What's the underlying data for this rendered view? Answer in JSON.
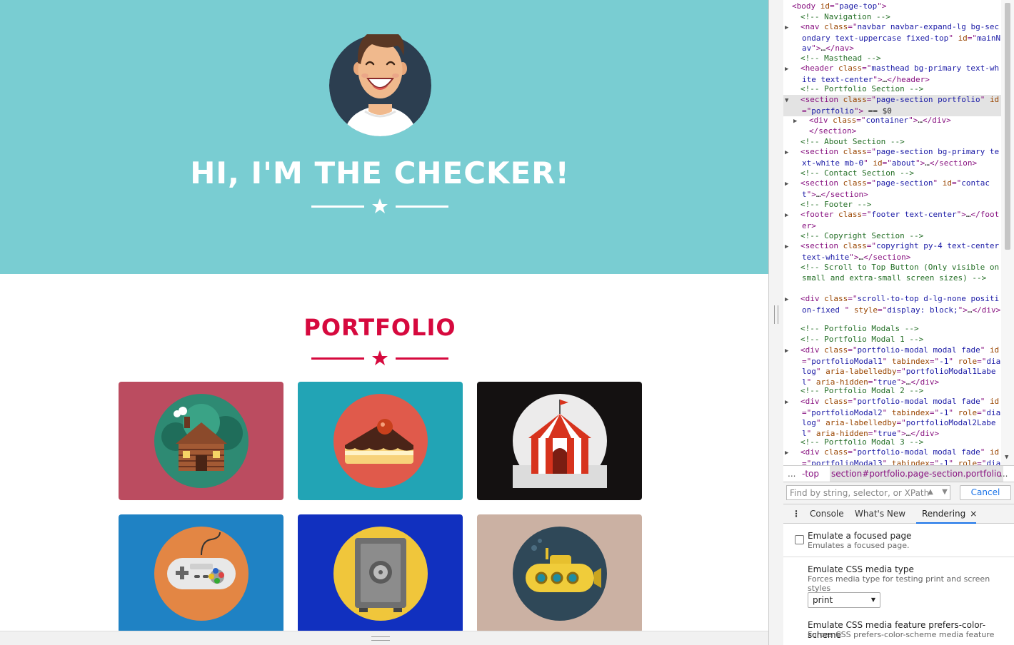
{
  "page": {
    "hero_title": "HI, I'M THE CHECKER!",
    "portfolio_title": "PORTFOLIO",
    "colors": {
      "masthead": "#79cdd2",
      "accent": "#d6093e",
      "white": "#ffffff"
    },
    "cards": [
      {
        "name": "cabin",
        "bg": "#bb4c60",
        "icon": "cabin-icon"
      },
      {
        "name": "cake",
        "bg": "#22a4b5",
        "icon": "cake-icon"
      },
      {
        "name": "circus",
        "bg": "#141111",
        "icon": "circus-tent-icon"
      },
      {
        "name": "game",
        "bg": "#1f82c4",
        "icon": "gamepad-icon"
      },
      {
        "name": "safe",
        "bg": "#1130bf",
        "icon": "safe-icon"
      },
      {
        "name": "submarine",
        "bg": "#cbb1a3",
        "icon": "submarine-icon"
      }
    ]
  },
  "devtools": {
    "tree": [
      {
        "indent": 0,
        "tri": "▼",
        "parts": [
          [
            "tag",
            "<body "
          ],
          [
            "attr",
            "id"
          ],
          [
            "tag",
            "=\""
          ],
          [
            "val",
            "page-top"
          ],
          [
            "tag",
            "\">"
          ]
        ]
      },
      {
        "indent": 1,
        "tri": "",
        "parts": [
          [
            "cmt",
            "<!-- Navigation -->"
          ]
        ]
      },
      {
        "indent": 1,
        "tri": "▶",
        "parts": [
          [
            "tag",
            "<nav "
          ],
          [
            "attr",
            "class"
          ],
          [
            "tag",
            "=\""
          ],
          [
            "val",
            "navbar navbar-expand-lg bg-secondary text-uppercase fixed-top"
          ],
          [
            "tag",
            "\" "
          ],
          [
            "attr",
            "id"
          ],
          [
            "tag",
            "=\""
          ],
          [
            "val",
            "mainNav"
          ],
          [
            "tag",
            "\">"
          ],
          [
            "txt",
            "…"
          ],
          [
            "tag",
            "</nav>"
          ]
        ]
      },
      {
        "indent": 1,
        "tri": "",
        "parts": [
          [
            "cmt",
            "<!-- Masthead -->"
          ]
        ]
      },
      {
        "indent": 1,
        "tri": "▶",
        "parts": [
          [
            "tag",
            "<header "
          ],
          [
            "attr",
            "class"
          ],
          [
            "tag",
            "=\""
          ],
          [
            "val",
            "masthead bg-primary text-white text-center"
          ],
          [
            "tag",
            "\">"
          ],
          [
            "txt",
            "…"
          ],
          [
            "tag",
            "</header>"
          ]
        ]
      },
      {
        "indent": 1,
        "tri": "",
        "parts": [
          [
            "cmt",
            "<!-- Portfolio Section -->"
          ]
        ]
      },
      {
        "indent": 1,
        "tri": "▼",
        "sel": true,
        "parts": [
          [
            "tag",
            "<section "
          ],
          [
            "attr",
            "class"
          ],
          [
            "tag",
            "=\""
          ],
          [
            "val",
            "page-section portfolio"
          ],
          [
            "tag",
            "\" "
          ],
          [
            "attr",
            "id"
          ],
          [
            "tag",
            "=\""
          ],
          [
            "val",
            "portfolio"
          ],
          [
            "tag",
            "\">"
          ],
          [
            "txt",
            " == $0"
          ]
        ]
      },
      {
        "indent": 2,
        "tri": "▶",
        "parts": [
          [
            "tag",
            "<div "
          ],
          [
            "attr",
            "class"
          ],
          [
            "tag",
            "=\""
          ],
          [
            "val",
            "container"
          ],
          [
            "tag",
            "\">"
          ],
          [
            "txt",
            "…"
          ],
          [
            "tag",
            "</div>"
          ]
        ]
      },
      {
        "indent": 2,
        "tri": "",
        "parts": [
          [
            "tag",
            "</section>"
          ]
        ]
      },
      {
        "indent": 1,
        "tri": "",
        "parts": [
          [
            "cmt",
            "<!-- About Section -->"
          ]
        ]
      },
      {
        "indent": 1,
        "tri": "▶",
        "parts": [
          [
            "tag",
            "<section "
          ],
          [
            "attr",
            "class"
          ],
          [
            "tag",
            "=\""
          ],
          [
            "val",
            "page-section bg-primary text-white mb-0"
          ],
          [
            "tag",
            "\" "
          ],
          [
            "attr",
            "id"
          ],
          [
            "tag",
            "=\""
          ],
          [
            "val",
            "about"
          ],
          [
            "tag",
            "\">"
          ],
          [
            "txt",
            "…"
          ],
          [
            "tag",
            "</section>"
          ]
        ]
      },
      {
        "indent": 1,
        "tri": "",
        "parts": [
          [
            "cmt",
            "<!-- Contact Section -->"
          ]
        ]
      },
      {
        "indent": 1,
        "tri": "▶",
        "parts": [
          [
            "tag",
            "<section "
          ],
          [
            "attr",
            "class"
          ],
          [
            "tag",
            "=\""
          ],
          [
            "val",
            "page-section"
          ],
          [
            "tag",
            "\" "
          ],
          [
            "attr",
            "id"
          ],
          [
            "tag",
            "=\""
          ],
          [
            "val",
            "contact"
          ],
          [
            "tag",
            "\">"
          ],
          [
            "txt",
            "…"
          ],
          [
            "tag",
            "</section>"
          ]
        ]
      },
      {
        "indent": 1,
        "tri": "",
        "parts": [
          [
            "cmt",
            "<!-- Footer -->"
          ]
        ]
      },
      {
        "indent": 1,
        "tri": "▶",
        "parts": [
          [
            "tag",
            "<footer "
          ],
          [
            "attr",
            "class"
          ],
          [
            "tag",
            "=\""
          ],
          [
            "val",
            "footer text-center"
          ],
          [
            "tag",
            "\">"
          ],
          [
            "txt",
            "…"
          ],
          [
            "tag",
            "</footer>"
          ]
        ]
      },
      {
        "indent": 1,
        "tri": "",
        "parts": [
          [
            "cmt",
            "<!-- Copyright Section -->"
          ]
        ]
      },
      {
        "indent": 1,
        "tri": "▶",
        "parts": [
          [
            "tag",
            "<section "
          ],
          [
            "attr",
            "class"
          ],
          [
            "tag",
            "=\""
          ],
          [
            "val",
            "copyright py-4 text-center text-white"
          ],
          [
            "tag",
            "\">"
          ],
          [
            "txt",
            "…"
          ],
          [
            "tag",
            "</section>"
          ]
        ]
      },
      {
        "indent": 1,
        "tri": "",
        "parts": [
          [
            "cmt",
            "<!-- Scroll to Top Button (Only visible on small and extra-small screen sizes) -->"
          ]
        ]
      },
      {
        "indent": 1,
        "tri": "▶",
        "parts": [
          [
            "tag",
            "<div "
          ],
          [
            "attr",
            "class"
          ],
          [
            "tag",
            "=\""
          ],
          [
            "val",
            "scroll-to-top d-lg-none position-fixed "
          ],
          [
            "tag",
            "\" "
          ],
          [
            "attr",
            "style"
          ],
          [
            "tag",
            "=\""
          ],
          [
            "val",
            "display: block;"
          ],
          [
            "tag",
            "\">"
          ],
          [
            "txt",
            "…"
          ],
          [
            "tag",
            "</div>"
          ]
        ]
      },
      {
        "indent": 1,
        "tri": "",
        "parts": [
          [
            "cmt",
            "<!-- Portfolio Modals -->"
          ]
        ]
      },
      {
        "indent": 1,
        "tri": "",
        "parts": [
          [
            "cmt",
            "<!-- Portfolio Modal 1 -->"
          ]
        ]
      },
      {
        "indent": 1,
        "tri": "▶",
        "parts": [
          [
            "tag",
            "<div "
          ],
          [
            "attr",
            "class"
          ],
          [
            "tag",
            "=\""
          ],
          [
            "val",
            "portfolio-modal modal fade"
          ],
          [
            "tag",
            "\" "
          ],
          [
            "attr",
            "id"
          ],
          [
            "tag",
            "=\""
          ],
          [
            "val",
            "portfolioModal1"
          ],
          [
            "tag",
            "\" "
          ],
          [
            "attr",
            "tabindex"
          ],
          [
            "tag",
            "=\""
          ],
          [
            "val",
            "-1"
          ],
          [
            "tag",
            "\" "
          ],
          [
            "attr",
            "role"
          ],
          [
            "tag",
            "=\""
          ],
          [
            "val",
            "dialog"
          ],
          [
            "tag",
            "\" "
          ],
          [
            "attr",
            "aria-labelledby"
          ],
          [
            "tag",
            "=\""
          ],
          [
            "val",
            "portfolioModal1Label"
          ],
          [
            "tag",
            "\" "
          ],
          [
            "attr",
            "aria-hidden"
          ],
          [
            "tag",
            "=\""
          ],
          [
            "val",
            "true"
          ],
          [
            "tag",
            "\">"
          ],
          [
            "txt",
            "…"
          ],
          [
            "tag",
            "</div>"
          ]
        ]
      },
      {
        "indent": 1,
        "tri": "",
        "parts": [
          [
            "cmt",
            "<!-- Portfolio Modal 2 -->"
          ]
        ]
      },
      {
        "indent": 1,
        "tri": "▶",
        "parts": [
          [
            "tag",
            "<div "
          ],
          [
            "attr",
            "class"
          ],
          [
            "tag",
            "=\""
          ],
          [
            "val",
            "portfolio-modal modal fade"
          ],
          [
            "tag",
            "\" "
          ],
          [
            "attr",
            "id"
          ],
          [
            "tag",
            "=\""
          ],
          [
            "val",
            "portfolioModal2"
          ],
          [
            "tag",
            "\" "
          ],
          [
            "attr",
            "tabindex"
          ],
          [
            "tag",
            "=\""
          ],
          [
            "val",
            "-1"
          ],
          [
            "tag",
            "\" "
          ],
          [
            "attr",
            "role"
          ],
          [
            "tag",
            "=\""
          ],
          [
            "val",
            "dialog"
          ],
          [
            "tag",
            "\" "
          ],
          [
            "attr",
            "aria-labelledby"
          ],
          [
            "tag",
            "=\""
          ],
          [
            "val",
            "portfolioModal2Label"
          ],
          [
            "tag",
            "\" "
          ],
          [
            "attr",
            "aria-hidden"
          ],
          [
            "tag",
            "=\""
          ],
          [
            "val",
            "true"
          ],
          [
            "tag",
            "\">"
          ],
          [
            "txt",
            "…"
          ],
          [
            "tag",
            "</div>"
          ]
        ]
      },
      {
        "indent": 1,
        "tri": "",
        "parts": [
          [
            "cmt",
            "<!-- Portfolio Modal 3 -->"
          ]
        ]
      },
      {
        "indent": 1,
        "tri": "▶",
        "parts": [
          [
            "tag",
            "<div "
          ],
          [
            "attr",
            "class"
          ],
          [
            "tag",
            "=\""
          ],
          [
            "val",
            "portfolio-modal modal fade"
          ],
          [
            "tag",
            "\" "
          ],
          [
            "attr",
            "id"
          ],
          [
            "tag",
            "=\""
          ],
          [
            "val",
            "portfolioModal3"
          ],
          [
            "tag",
            "\" "
          ],
          [
            "attr",
            "tabindex"
          ],
          [
            "tag",
            "=\""
          ],
          [
            "val",
            "-1"
          ],
          [
            "tag",
            "\" "
          ],
          [
            "attr",
            "role"
          ],
          [
            "tag",
            "=\""
          ],
          [
            "val",
            "dialog"
          ],
          [
            "tag",
            "\">"
          ]
        ]
      }
    ],
    "breadcrumbs": {
      "more_left": "...",
      "prev": "-top",
      "current": "section#portfolio.page-section.portfolio",
      "more_right": "..."
    },
    "find": {
      "placeholder": "Find by string, selector, or XPath",
      "prev_icon": "chevron-up-icon",
      "next_icon": "chevron-down-icon",
      "cancel_label": "Cancel"
    },
    "drawer_tabs": {
      "menu": "⋮",
      "console": "Console",
      "whats_new": "What's New",
      "rendering": "Rendering",
      "close": "×"
    },
    "rendering": {
      "focused_title": "Emulate a focused page",
      "focused_desc": "Emulates a focused page.",
      "focused_checked": false,
      "media_title": "Emulate CSS media type",
      "media_desc": "Forces media type for testing print and screen styles",
      "media_value": "print",
      "scheme_title": "Emulate CSS media feature prefers-color-scheme",
      "scheme_desc": "Forces CSS prefers-color-scheme media feature"
    }
  }
}
